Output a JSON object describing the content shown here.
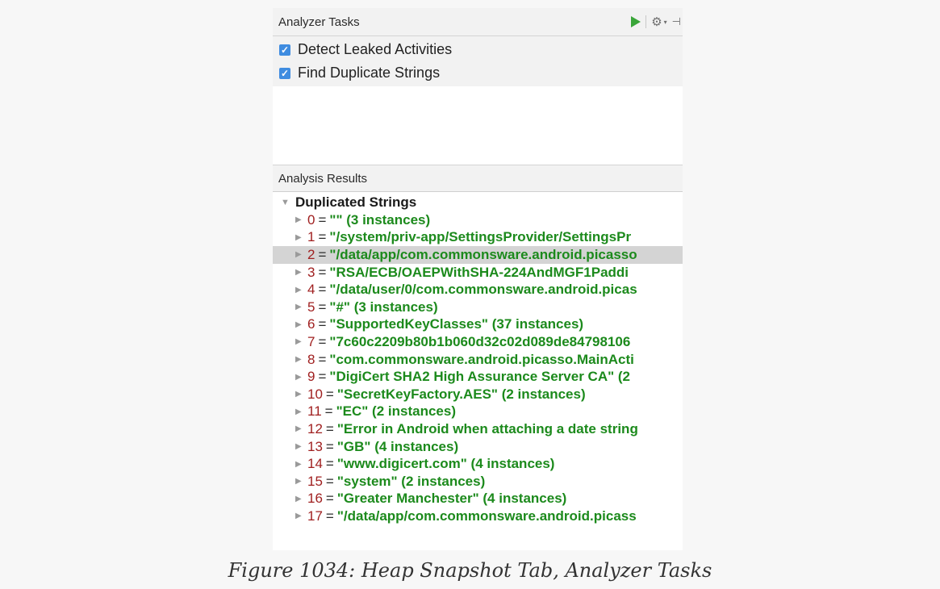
{
  "analyzer_tasks": {
    "title": "Analyzer Tasks",
    "items": [
      {
        "label": "Detect Leaked Activities",
        "checked": true
      },
      {
        "label": "Find Duplicate Strings",
        "checked": true
      }
    ]
  },
  "analysis_results": {
    "title": "Analysis Results",
    "group_label": "Duplicated Strings",
    "rows": [
      {
        "index": "0",
        "value": "\"\" (3 instances)"
      },
      {
        "index": "1",
        "value": "\"/system/priv-app/SettingsProvider/SettingsPr"
      },
      {
        "index": "2",
        "value": "\"/data/app/com.commonsware.android.picasso"
      },
      {
        "index": "3",
        "value": "\"RSA/ECB/OAEPWithSHA-224AndMGF1Paddi"
      },
      {
        "index": "4",
        "value": "\"/data/user/0/com.commonsware.android.picas"
      },
      {
        "index": "5",
        "value": "\"#\" (3 instances)"
      },
      {
        "index": "6",
        "value": "\"SupportedKeyClasses\" (37 instances)"
      },
      {
        "index": "7",
        "value": "\"7c60c2209b80b1b060d32c02d089de84798106"
      },
      {
        "index": "8",
        "value": "\"com.commonsware.android.picasso.MainActi"
      },
      {
        "index": "9",
        "value": "\"DigiCert SHA2 High Assurance Server CA\" (2"
      },
      {
        "index": "10",
        "value": "\"SecretKeyFactory.AES\" (2 instances)"
      },
      {
        "index": "11",
        "value": "\"EC\" (2 instances)"
      },
      {
        "index": "12",
        "value": "\"Error in Android when attaching a date string"
      },
      {
        "index": "13",
        "value": "\"GB\" (4 instances)"
      },
      {
        "index": "14",
        "value": "\"www.digicert.com\" (4 instances)"
      },
      {
        "index": "15",
        "value": "\"system\" (2 instances)"
      },
      {
        "index": "16",
        "value": "\"Greater Manchester\" (4 instances)"
      },
      {
        "index": "17",
        "value": "\"/data/app/com.commonsware.android.picass"
      }
    ],
    "selected_index": 2
  },
  "caption": "Figure 1034: Heap Snapshot Tab, Analyzer Tasks",
  "colors": {
    "accent_run": "#3aa639",
    "index_red": "#a02020",
    "value_green": "#1c8a1c",
    "checkbox_blue": "#3f8ce0"
  }
}
